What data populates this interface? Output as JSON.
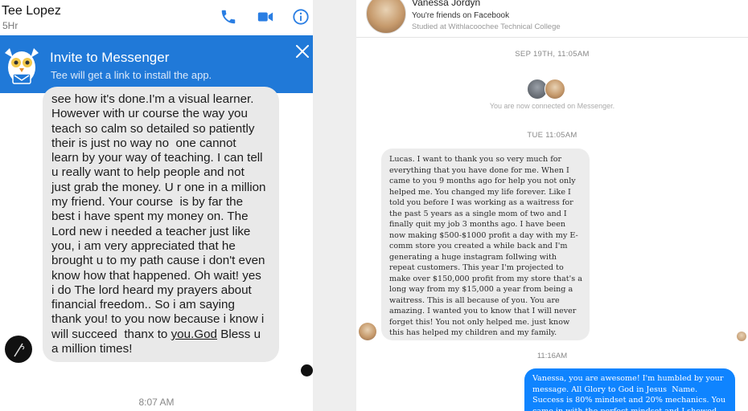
{
  "left": {
    "header": {
      "name": "Tee Lopez",
      "subtitle": "5Hr"
    },
    "invite": {
      "title": "Invite to Messenger",
      "subtitle": "Tee will get a link to install the app."
    },
    "message": {
      "text_before": "see how it's done.I'm a visual learner.\nHowever with ur course the way you\nteach so calm so detailed so patiently\ntheir is just no way no  one cannot\nlearn by your way of teaching. I can tell\nu really want to help people and not\njust grab the money. U r one in a million\nmy friend. Your course  is by far the\nbest i have spent my money on. The\nLord new i needed a teacher just like\nyou, i am very appreciated that he\nbrought u to my path cause i don't even\nknow how that happened. Oh wait! yes\ni do The lord heard my prayers about\nfinancial freedom.. So i am saying\nthank you! to you now because i know i\nwill succeed  thanx to ",
      "link_text": "you.God",
      "text_after": " Bless u\na million times!"
    },
    "timestamp": "8:07 AM"
  },
  "right": {
    "header": {
      "name": "Vanessa Jordyn",
      "friends": "You're friends on Facebook",
      "studied": "Studied at Withlacoochee Technical College"
    },
    "date_1": "SEP 19TH, 11:05AM",
    "connected": "You are now connected on Messenger.",
    "date_2": "TUE 11:05AM",
    "message": "Lucas. I want to thank you so very much for\neverything that you have done for me. When I\ncame to you 9 months ago for help you not only\nhelped me. You changed my life forever. Like I\ntold you before I was working as a waitress for\nthe past 5 years as a single mom of two and I\nfinally quit my job 3 months ago. I have been\nnow making $500-$1000 profit a day with my E-\ncomm store you created a while back and I'm\ngenerating a huge instagram follwing with\nrepeat customers. This year I'm projected to\nmake over $150,000 profit from my store that's a\nlong way from my $15,000 a year from being a\nwaitress. This is all because of you. You are\namazing. I wanted you to know that I will never\nforget this! You not only helped me. just know\nthis has helped my children and my family.",
    "time_3": "11:16AM",
    "reply": "Vanessa, you are awesome! I'm humbled by your\nmessage. All Glory to God in Jesus  Name.\nSuccess is 80% mindset and 20% mechanics. You\ncame in with the perfect mindset and I showed"
  },
  "colors": {
    "messenger_blue": "#2079d8",
    "bubble_blue": "#0f84ff",
    "bubble_gray": "#e9e9e9"
  },
  "icons": [
    "phone-icon",
    "video-camera-icon",
    "info-icon",
    "close-icon",
    "messenger-owl-logo"
  ]
}
